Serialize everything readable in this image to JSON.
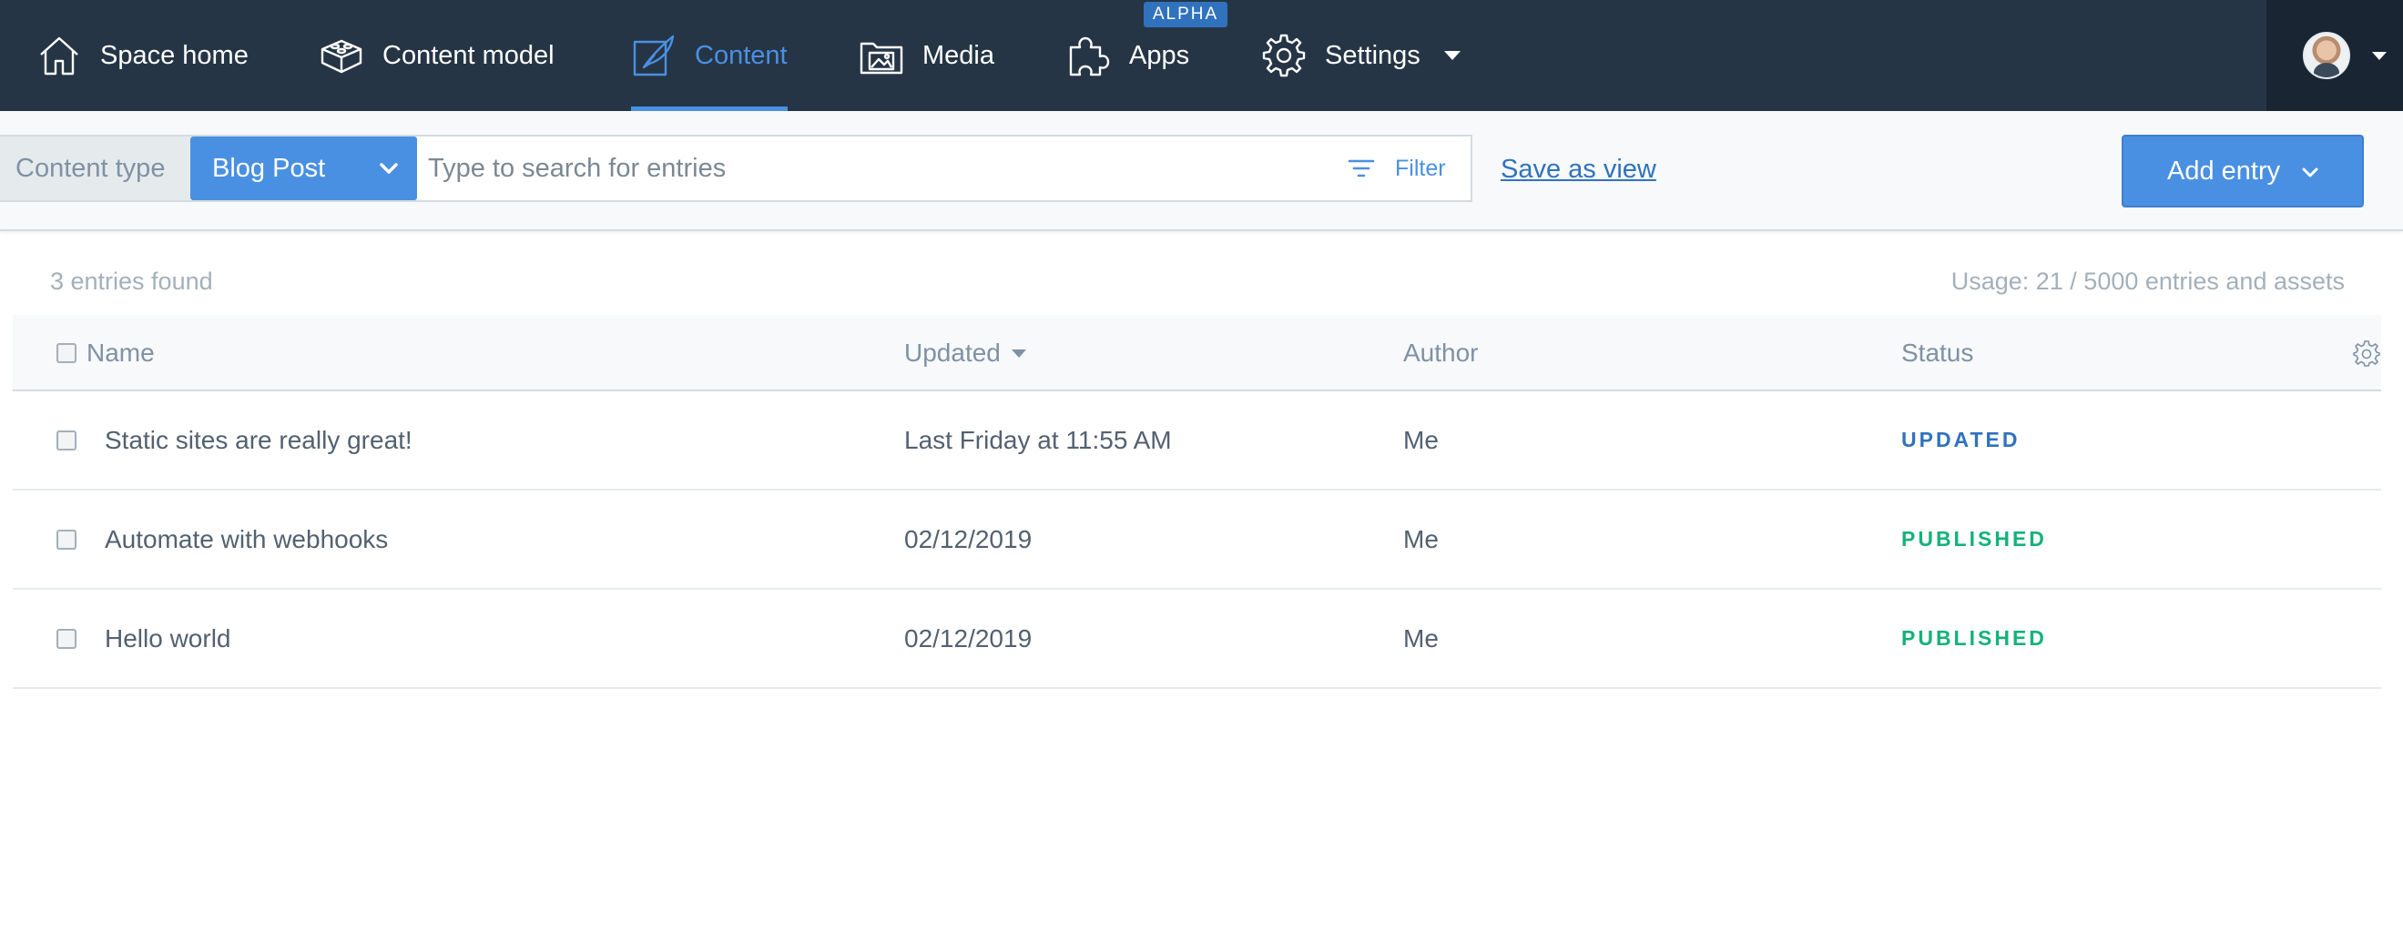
{
  "nav": {
    "items": [
      {
        "label": "Space home",
        "icon": "home-icon"
      },
      {
        "label": "Content model",
        "icon": "content-model-icon"
      },
      {
        "label": "Content",
        "icon": "quill-icon",
        "active": true
      },
      {
        "label": "Media",
        "icon": "media-icon"
      },
      {
        "label": "Apps",
        "icon": "puzzle-icon",
        "badge": "ALPHA"
      },
      {
        "label": "Settings",
        "icon": "gear-icon"
      }
    ],
    "active_color": "#4a90e2",
    "background": "#253545"
  },
  "toolbar": {
    "content_type_label": "Content type",
    "content_type_value": "Blog Post",
    "search_placeholder": "Type to search for entries",
    "filter_label": "Filter",
    "save_view_label": "Save as view",
    "add_entry_label": "Add entry"
  },
  "summary": {
    "entries_found": "3 entries found",
    "usage": "Usage: 21 / 5000 entries and assets"
  },
  "table": {
    "columns": [
      "Name",
      "Updated",
      "Author",
      "Status"
    ],
    "rows": [
      {
        "name": "Static sites are really great!",
        "updated": "Last Friday at 11:55 AM",
        "author": "Me",
        "status": "UPDATED",
        "status_color": "#3072be"
      },
      {
        "name": "Automate with webhooks",
        "updated": "02/12/2019",
        "author": "Me",
        "status": "PUBLISHED",
        "status_color": "#14b279"
      },
      {
        "name": "Hello world",
        "updated": "02/12/2019",
        "author": "Me",
        "status": "PUBLISHED",
        "status_color": "#14b279"
      }
    ]
  }
}
